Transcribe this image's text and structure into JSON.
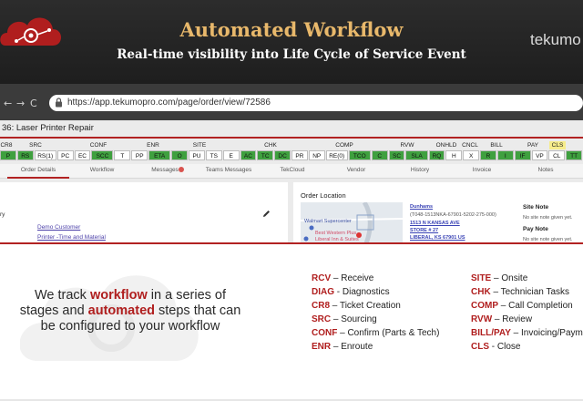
{
  "banner": {
    "title": "Automated Workflow",
    "subtitle": "Real-time visibility into Life Cycle of Service Event",
    "brand": "tekumo"
  },
  "browser": {
    "back": "←",
    "forward": "→",
    "reload": "C",
    "url": "https://app.tekumopro.com/page/order/view/72586"
  },
  "order": {
    "title": "36: Laser Printer Repair",
    "stage_groups": [
      "CR8",
      "SRC",
      "CONF",
      "ENR",
      "SITE",
      "CHK",
      "COMP",
      "RVW",
      "ONHLD",
      "CNCL",
      "BILL",
      "PAY",
      "CLS"
    ],
    "statuses": [
      {
        "label": "P",
        "color": "#3fa03f"
      },
      {
        "label": "RS",
        "color": "#3fa03f"
      },
      {
        "label": "RS(1)",
        "color": "#ffffff"
      },
      {
        "label": "PC",
        "color": "#ffffff"
      },
      {
        "label": "EC",
        "color": "#ffffff"
      },
      {
        "label": "SCC",
        "color": "#3fa03f"
      },
      {
        "label": "T",
        "color": "#ffffff"
      },
      {
        "label": "PP",
        "color": "#ffffff"
      },
      {
        "label": "ETA",
        "color": "#3fa03f"
      },
      {
        "label": "O",
        "color": "#3fa03f"
      },
      {
        "label": "PU",
        "color": "#ffffff"
      },
      {
        "label": "TS",
        "color": "#ffffff"
      },
      {
        "label": "E",
        "color": "#ffffff"
      },
      {
        "label": "AC",
        "color": "#3fa03f"
      },
      {
        "label": "TC",
        "color": "#3fa03f"
      },
      {
        "label": "DC",
        "color": "#3fa03f"
      },
      {
        "label": "PR",
        "color": "#ffffff"
      },
      {
        "label": "NP",
        "color": "#ffffff"
      },
      {
        "label": "RE(0)",
        "color": "#ffffff"
      },
      {
        "label": "TCO",
        "color": "#3fa03f"
      },
      {
        "label": "C",
        "color": "#3fa03f"
      },
      {
        "label": "SC",
        "color": "#3fa03f"
      },
      {
        "label": "SLA",
        "color": "#3fa03f"
      },
      {
        "label": "RQ",
        "color": "#3fa03f"
      },
      {
        "label": "H",
        "color": "#ffffff"
      },
      {
        "label": "X",
        "color": "#ffffff"
      },
      {
        "label": "R",
        "color": "#3fa03f"
      },
      {
        "label": "I",
        "color": "#3fa03f"
      },
      {
        "label": "IF",
        "color": "#3fa03f"
      },
      {
        "label": "VP",
        "color": "#ffffff"
      },
      {
        "label": "CL",
        "color": "#ffffff"
      },
      {
        "label": "TT",
        "color": "#3fa03f"
      }
    ],
    "tabs": [
      "Order Details",
      "Workflow",
      "Messages",
      "Teams Messages",
      "TekCloud",
      "Vendor",
      "History",
      "Invoice",
      "Notes"
    ],
    "left_panel": {
      "label": "ry",
      "customer": "Demo Customer",
      "service": "Printer -Time and Material"
    },
    "location": {
      "title": "Order Location",
      "map_labels": [
        "Walmart Supercenter",
        "Best Western Plus",
        "Liberal Inn & Suites"
      ],
      "store_name": "Dunhams",
      "store_code": "(T048-1513NKA-67901-5202-275-000)",
      "address1": "1513 N KANSAS AVE",
      "address2": "STORE # 27",
      "address3": "LIBERAL, KS 67901 US",
      "site_note_h": "Site Note",
      "site_note_v": "No site note given yet.",
      "pay_note_h": "Pay Note",
      "pay_note_v": "No site note given yet."
    }
  },
  "tagline": {
    "p1": "We track ",
    "w1": "workflow",
    "p2": " in a series of stages and ",
    "w2": "automated",
    "p3": " steps that can be configured to your workflow"
  },
  "abbreviations": {
    "left": [
      {
        "code": "RCV",
        "desc": " – Receive"
      },
      {
        "code": "DIAG",
        "desc": " - Diagnostics"
      },
      {
        "code": "CR8",
        "desc": " – Ticket Creation"
      },
      {
        "code": "SRC",
        "desc": " – Sourcing"
      },
      {
        "code": "CONF",
        "desc": " – Confirm (Parts & Tech)"
      },
      {
        "code": "ENR",
        "desc": " – Enroute"
      }
    ],
    "right": [
      {
        "code": "SITE",
        "desc": " – Onsite"
      },
      {
        "code": "CHK",
        "desc": " – Technician Tasks"
      },
      {
        "code": "COMP",
        "desc": " – Call Completion"
      },
      {
        "code": "RVW",
        "desc": " – Review"
      },
      {
        "code": "BILL/PAY",
        "desc": " – Invoicing/Payment"
      },
      {
        "code": "CLS",
        "desc": " - Close"
      }
    ]
  },
  "colors": {
    "accent": "#b01e1e",
    "banner_title": "#e8b86b",
    "status_green": "#3fa03f"
  }
}
